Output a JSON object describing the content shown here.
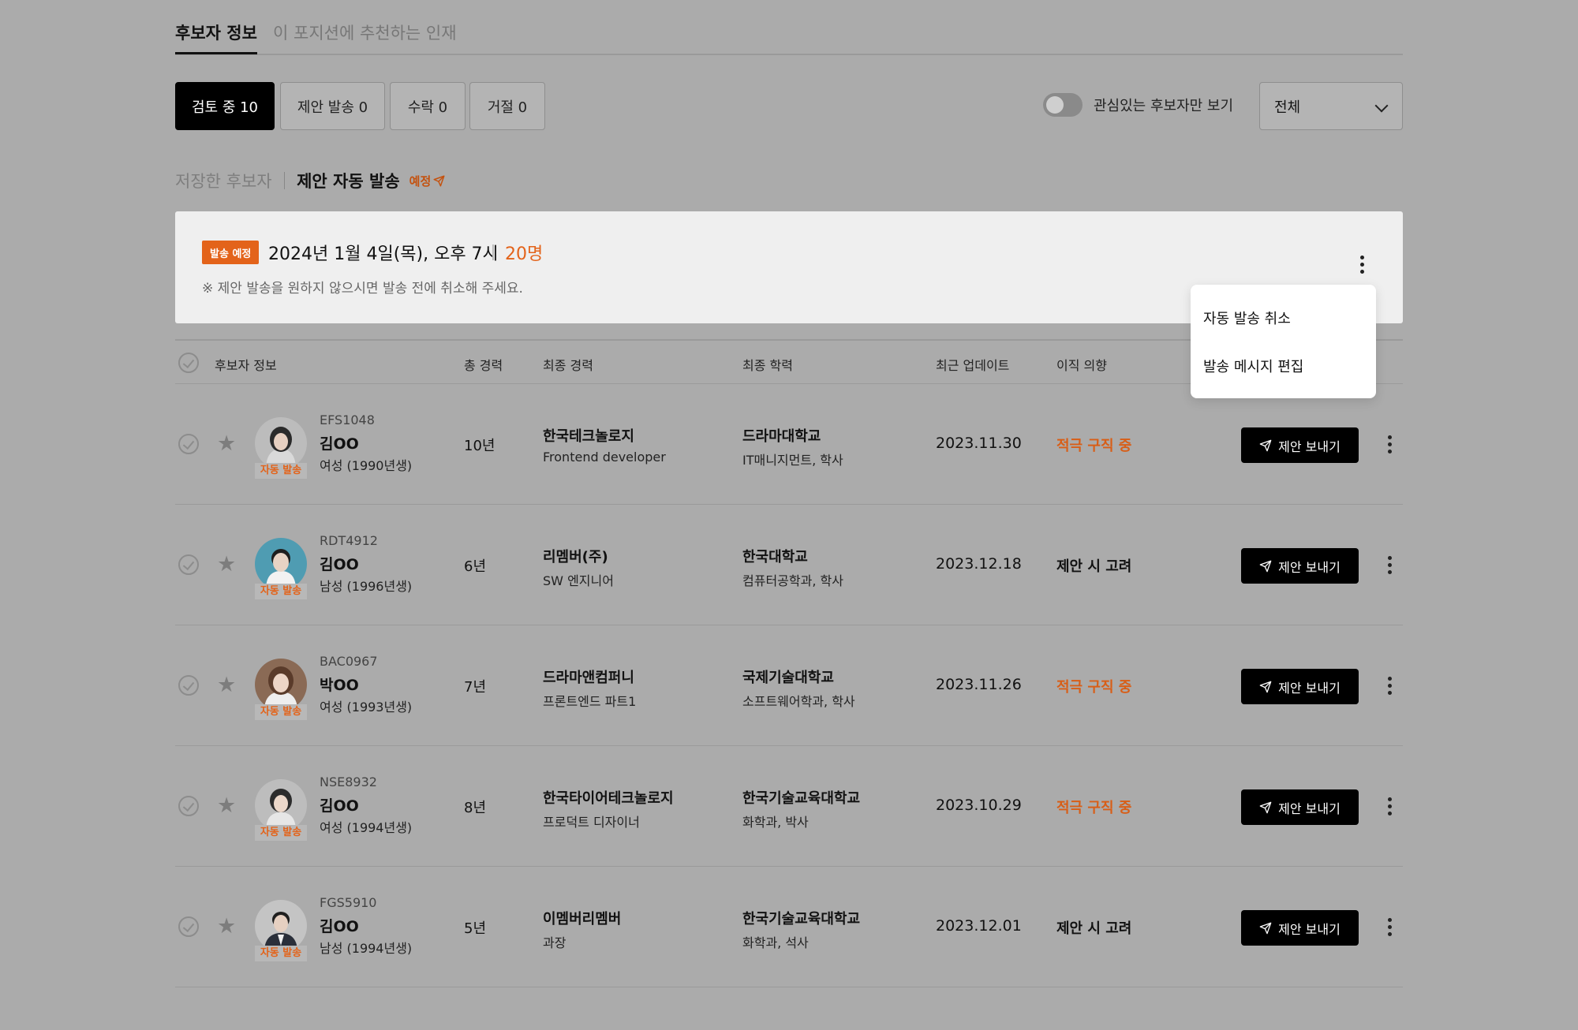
{
  "tabs": {
    "candidate_info": "후보자 정보",
    "recommended": "이 포지션에 추천하는 인재"
  },
  "status_buttons": {
    "reviewing": "검토 중 10",
    "offer_sent": "제안 발송 0",
    "accepted": "수락 0",
    "rejected": "거절 0"
  },
  "filter": {
    "toggle_label": "관심있는 후보자만 보기",
    "toggle_on": false,
    "select_value": "전체"
  },
  "section": {
    "saved": "저장한 후보자",
    "auto_send": "제안 자동 발송",
    "scheduled": "예정"
  },
  "schedule_card": {
    "badge": "발송 예정",
    "datetime": "2024년 1월 4일(목), 오후 7시",
    "count": "20명",
    "note": "※ 제안 발송을 원하지 않으시면 발송 전에 취소해 주세요."
  },
  "popup_menu": {
    "cancel_auto_send": "자동 발송 취소",
    "edit_message": "발송 메시지 편집"
  },
  "table_headers": {
    "candidate": "후보자 정보",
    "experience": "총 경력",
    "last_career": "최종 경력",
    "last_education": "최종 학력",
    "updated": "최근 업데이트",
    "intent": "이직 의향"
  },
  "auto_tag": "자동 발송",
  "send_label": "제안 보내기",
  "colors": {
    "accent": "#e3631a",
    "background": "#ababab",
    "button": "#000000"
  },
  "rows": [
    {
      "id": "EFS1048",
      "name": "김OO",
      "gender": "여성 (1990년생)",
      "experience": "10년",
      "company": "한국테크놀로지",
      "role": "Frontend developer",
      "school": "드라마대학교",
      "major": "IT매니지먼트, 학사",
      "updated": "2023.11.30",
      "intent": "적극 구직 중",
      "intent_type": "active",
      "avatar": "female"
    },
    {
      "id": "RDT4912",
      "name": "김OO",
      "gender": "남성 (1996년생)",
      "experience": "6년",
      "company": "리멤버(주)",
      "role": "SW 엔지니어",
      "school": "한국대학교",
      "major": "컴퓨터공학과, 학사",
      "updated": "2023.12.18",
      "intent": "제안 시 고려",
      "intent_type": "consider",
      "avatar": "male-blue"
    },
    {
      "id": "BAC0967",
      "name": "박OO",
      "gender": "여성 (1993년생)",
      "experience": "7년",
      "company": "드라마앤컴퍼니",
      "role": "프론트엔드 파트1",
      "school": "국제기술대학교",
      "major": "소프트웨어학과, 학사",
      "updated": "2023.11.26",
      "intent": "적극 구직 중",
      "intent_type": "active",
      "avatar": "female-brown"
    },
    {
      "id": "NSE8932",
      "name": "김OO",
      "gender": "여성 (1994년생)",
      "experience": "8년",
      "company": "한국타이어테크놀로지",
      "role": "프로덕트 디자이너",
      "school": "한국기술교육대학교",
      "major": "화학과, 박사",
      "updated": "2023.10.29",
      "intent": "적극 구직 중",
      "intent_type": "active",
      "avatar": "female"
    },
    {
      "id": "FGS5910",
      "name": "김OO",
      "gender": "남성 (1994년생)",
      "experience": "5년",
      "company": "이멤버리멤버",
      "role": "과장",
      "school": "한국기술교육대학교",
      "major": "화학과, 석사",
      "updated": "2023.12.01",
      "intent": "제안 시 고려",
      "intent_type": "consider",
      "avatar": "male-suit"
    }
  ]
}
